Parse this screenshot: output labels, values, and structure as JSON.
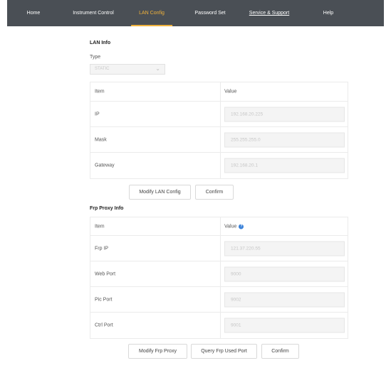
{
  "nav": {
    "home": "Home",
    "instrument_control": "Instrument Control",
    "lan_config": "LAN Config",
    "password_set": "Password Set",
    "service_support": "Service & Support",
    "help": "Help",
    "active_color": "#f0b23c"
  },
  "lan_info": {
    "title": "LAN Info",
    "type_label": "Type",
    "type_value": "STATIC",
    "table": {
      "col_item": "Item",
      "col_value": "Value",
      "rows": [
        {
          "item": "IP",
          "value": "192.168.20.225"
        },
        {
          "item": "Mask",
          "value": "255.255.255.0"
        },
        {
          "item": "Gateway",
          "value": "192.168.20.1"
        }
      ]
    },
    "modify_button": "Modify LAN Config",
    "confirm_button": "Confirm"
  },
  "frp_info": {
    "title": "Frp Proxy Info",
    "table": {
      "col_item": "Item",
      "col_value": "Value",
      "rows": [
        {
          "item": "Frp IP",
          "value": "121.37.220.55"
        },
        {
          "item": "Web Port",
          "value": "9000"
        },
        {
          "item": "Pic Port",
          "value": "9002"
        },
        {
          "item": "Ctrl Port",
          "value": "9001"
        }
      ]
    },
    "modify_button": "Modify Frp Proxy",
    "query_button": "Query Frp Used Port",
    "confirm_button": "Confirm"
  }
}
